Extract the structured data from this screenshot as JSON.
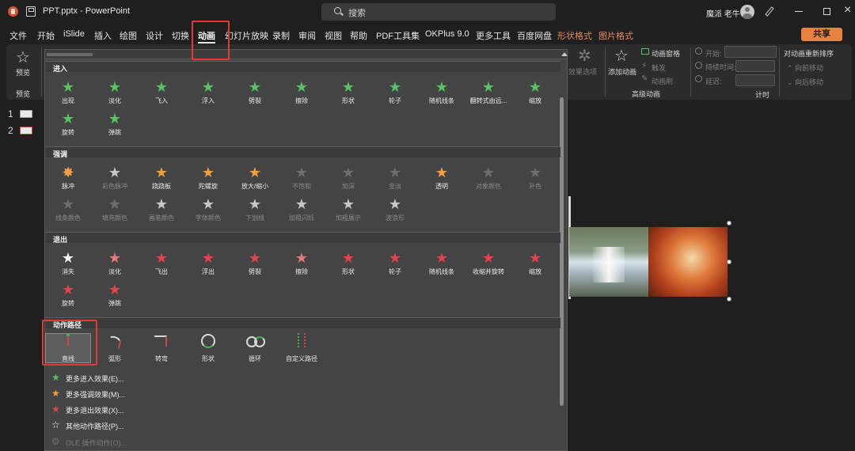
{
  "titlebar": {
    "doc_title": "PPT.pptx  -  PowerPoint",
    "search_placeholder": "搜索",
    "username": "魔派 老牛"
  },
  "menu": {
    "tabs": [
      "文件",
      "开始",
      "iSlide",
      "插入",
      "绘图",
      "设计",
      "切换",
      "动画",
      "幻灯片放映",
      "录制",
      "审阅",
      "视图",
      "帮助",
      "PDF工具集",
      "OKPlus 9.0",
      "更多工具",
      "百度网盘"
    ],
    "context_tabs": [
      "形状格式",
      "图片格式"
    ],
    "active_tab": "动画",
    "share": "共享"
  },
  "ribbon": {
    "preview": "预览",
    "preview_group": "预览",
    "effect_options": "效果选项",
    "add_animation": "添加动画",
    "animation_pane": "动画窗格",
    "trigger": "触发",
    "animation_painter": "动画刷",
    "advanced_group": "高级动画",
    "start": "开始:",
    "duration": "持续时间:",
    "delay": "延迟:",
    "timing_group": "计时",
    "reorder": "对动画重新排序",
    "move_earlier": "向前移动",
    "move_later": "向后移动"
  },
  "thumbnails": [
    "1",
    "2"
  ],
  "dropdown": {
    "entrance": {
      "title": "进入",
      "items": [
        "出现",
        "淡化",
        "飞入",
        "浮入",
        "劈裂",
        "擦除",
        "形状",
        "轮子",
        "随机线条",
        "翻转式由远...",
        "缩放",
        "旋转",
        "弹跳"
      ]
    },
    "emphasis": {
      "title": "强调",
      "items": [
        "脉冲",
        "彩色脉冲",
        "跷跷板",
        "陀螺旋",
        "放大/缩小",
        "不饱和",
        "加深",
        "变淡",
        "透明",
        "对象颜色",
        "补色",
        "线条颜色",
        "填充颜色",
        "画笔颜色",
        "字体颜色",
        "下划线",
        "加粗闪烁",
        "加粗展示",
        "波浪形"
      ]
    },
    "exit": {
      "title": "退出",
      "items": [
        "消失",
        "淡化",
        "飞出",
        "浮出",
        "劈裂",
        "擦除",
        "形状",
        "轮子",
        "随机线条",
        "收缩并旋转",
        "缩放",
        "旋转",
        "弹跳"
      ]
    },
    "motion": {
      "title": "动作路径",
      "items": [
        "直线",
        "弧形",
        "转弯",
        "形状",
        "循环",
        "自定义路径"
      ]
    },
    "more": [
      "更多进入效果(E)...",
      "更多强调效果(M)...",
      "更多退出效果(X)...",
      "其他动作路径(P)...",
      "OLE 操作动作(O)..."
    ]
  }
}
